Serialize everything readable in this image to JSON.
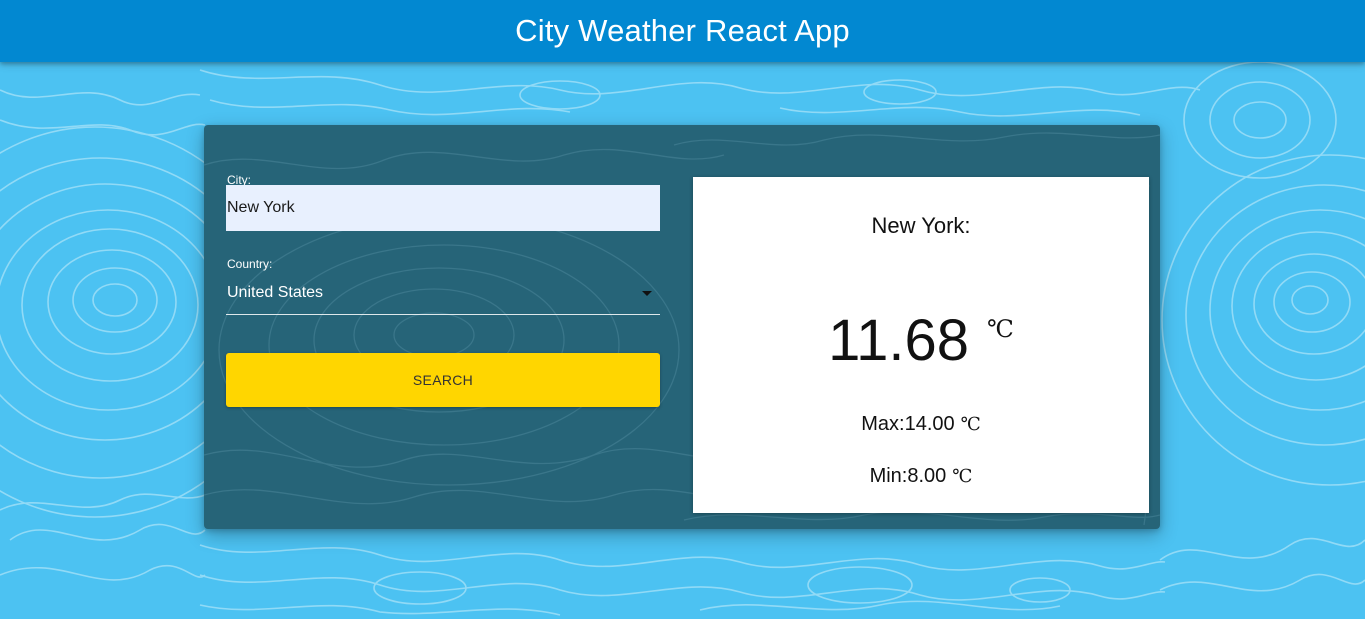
{
  "app": {
    "title": "City Weather React App"
  },
  "form": {
    "city_label": "City:",
    "city_value": "New York",
    "country_label": "Country:",
    "country_value": "United States",
    "search_label": "SEARCH"
  },
  "weather": {
    "city_heading": "New York:",
    "temperature": "11.68",
    "unit": "℃",
    "max_text": "Max:14.00",
    "min_text": "Min:8.00"
  },
  "icons": {
    "country_dropdown": "caret-down-icon"
  },
  "colors": {
    "app_bar": "#0288d1",
    "page_background": "#4cc2f2",
    "panel_background": "#266478",
    "search_button": "#ffd600",
    "city_input_background": "#e8f0fe",
    "weather_card": "#ffffff"
  }
}
